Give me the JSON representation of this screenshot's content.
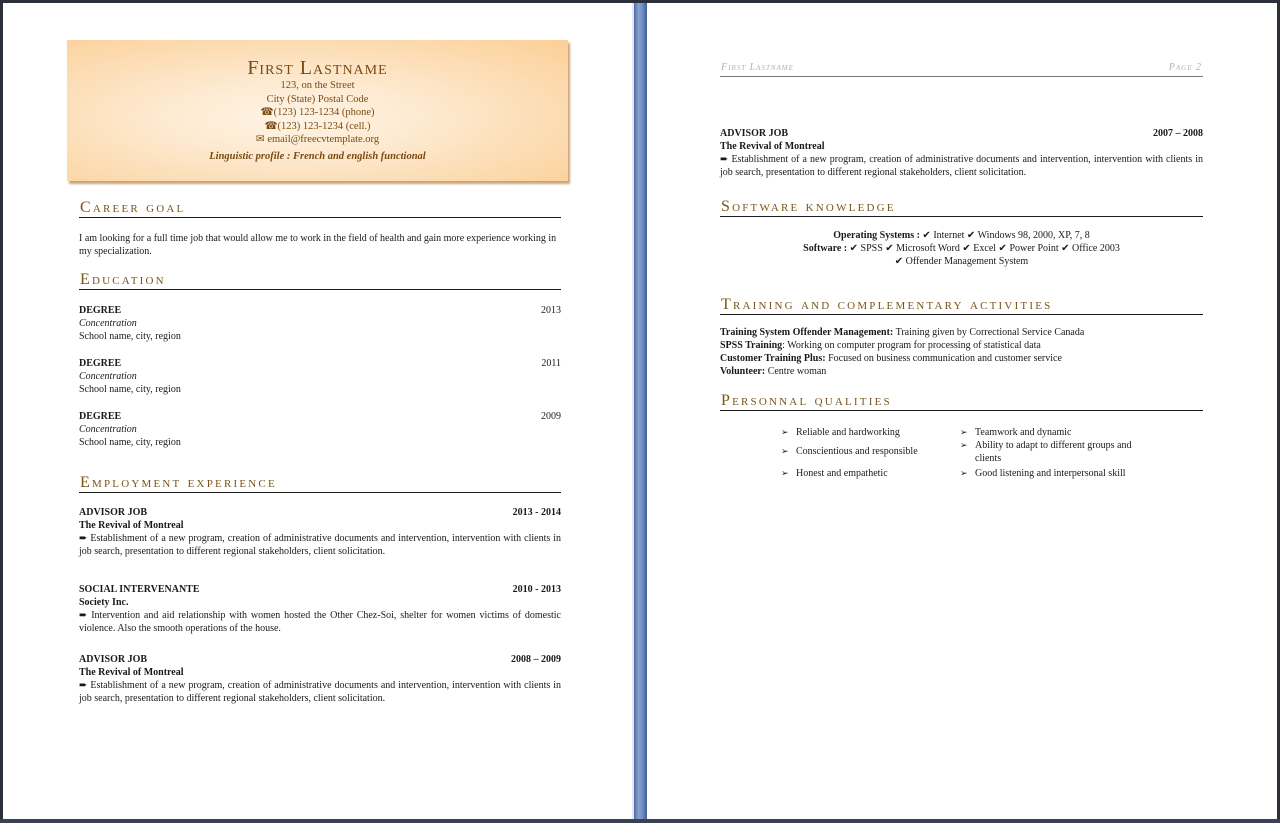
{
  "page1": {
    "header": {
      "name": "First Lastname",
      "address_line1": "123, on the Street",
      "address_line2": "City (State) Postal Code",
      "phone": "(123) 123-1234 (phone)",
      "cell": "(123) 123-1234 (cell.)",
      "email": "email@freecvtemplate.org",
      "phone_icon": "☎",
      "email_icon": "✉",
      "linguistic_profile": "Linguistic profile : French and english functional"
    },
    "career_goal": {
      "heading": "Career goal",
      "text": "I am looking for a full time job that would allow me to work in the field of health and gain more experience working in my specialization."
    },
    "education": {
      "heading": "Education",
      "entries": [
        {
          "degree": "DEGREE",
          "year": "2013",
          "concentration": "Concentration",
          "school": "School name, city, region"
        },
        {
          "degree": "DEGREE",
          "year": "2011",
          "concentration": "Concentration",
          "school": "School name, city, region"
        },
        {
          "degree": "DEGREE",
          "year": "2009",
          "concentration": "Concentration",
          "school": "School name, city, region"
        }
      ]
    },
    "employment": {
      "heading": "Employment experience",
      "bullet_icon": "➨",
      "entries": [
        {
          "title": "ADVISOR JOB",
          "dates": "2013 - 2014",
          "employer": "The Revival of Montreal",
          "description": "Establishment of a new program, creation of administrative documents and intervention, intervention with clients in job search, presentation to different regional stakeholders, client solicitation."
        },
        {
          "title": "SOCIAL INTERVENANTE",
          "dates": "2010 - 2013",
          "employer": "Society Inc.",
          "description": "Intervention and aid relationship with women hosted the Other Chez-Soi, shelter for women victims of domestic violence. Also the smooth operations of the house."
        },
        {
          "title": "ADVISOR JOB",
          "dates": "2008 – 2009",
          "employer": "The Revival of Montreal",
          "description": "Establishment of a new program, creation of administrative documents and intervention, intervention with clients in job search, presentation to different regional stakeholders, client solicitation."
        }
      ]
    }
  },
  "page2": {
    "running_header": {
      "name": "First Lastname",
      "page": "Page 2"
    },
    "employment_continued": {
      "title": "ADVISOR JOB",
      "dates": "2007 – 2008",
      "employer": "The Revival of Montreal",
      "bullet_icon": "➨",
      "description": "Establishment of a new program, creation of administrative documents and intervention, intervention with clients in job search, presentation to different regional stakeholders, client solicitation."
    },
    "software": {
      "heading": "Software knowledge",
      "check_icon": "✔",
      "os_label": "Operating Systems :",
      "os_items": [
        "Internet",
        "Windows 98, 2000, XP, 7, 8"
      ],
      "software_label": "Software :",
      "software_items": [
        "SPSS",
        "Microsoft Word",
        "Excel",
        "Power Point",
        "Office 2003"
      ],
      "extra_item": "Offender Management System"
    },
    "training": {
      "heading": "Training and complementary activities",
      "entries": [
        {
          "label": "Training System Offender Management:",
          "text": "Training given by Correctional Service Canada"
        },
        {
          "label": "SPSS Training",
          "text": ": Working on computer program for processing of statistical data"
        },
        {
          "label": "Customer Training Plus:",
          "text": "Focused on business communication and customer service"
        },
        {
          "label": "Volunteer:",
          "text": "Centre woman"
        }
      ]
    },
    "qualities": {
      "heading": "Personnal qualities",
      "bullet_icon": "➢",
      "column1": [
        "Reliable and hardworking",
        "Conscientious and responsible",
        "Honest and empathetic"
      ],
      "column2": [
        "Teamwork and dynamic",
        "Ability to adapt to different groups and clients",
        "Good listening and interpersonal skill"
      ]
    }
  }
}
